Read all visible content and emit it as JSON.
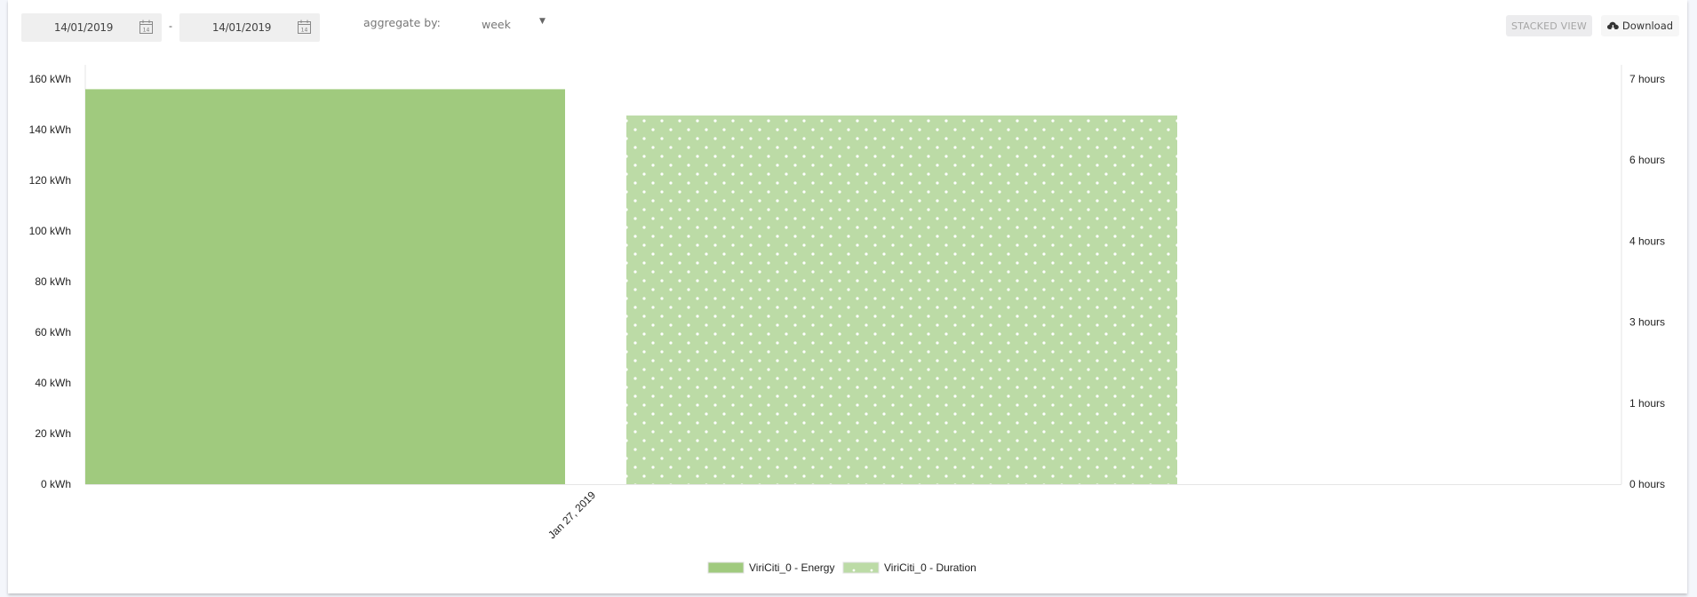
{
  "toolbar": {
    "start_date": "14/01/2019",
    "end_date": "14/01/2019",
    "date_separator": "-",
    "calendar_icon_day": "14",
    "aggregate_label": "aggregate by:",
    "aggregate_value": "week",
    "stacked_view_label": "STACKED VIEW",
    "download_label": "Download"
  },
  "colors": {
    "energy": "#a0ca7e",
    "duration": "#bcdba6",
    "page_background": "#f4f6fb"
  },
  "chart_data": {
    "type": "bar",
    "title": "",
    "categories": [
      "Jan 27, 2019"
    ],
    "series": [
      {
        "name": "ViriCiti_0 - Energy",
        "axis": "left",
        "unit": "kWh",
        "values": [
          156
        ],
        "pattern": "solid"
      },
      {
        "name": "ViriCiti_0 - Duration",
        "axis": "right",
        "unit": "hours",
        "values": [
          6.37
        ],
        "pattern": "dots"
      }
    ],
    "y_left": {
      "label": "",
      "range": [
        0,
        160
      ],
      "ticks": [
        0,
        20,
        40,
        60,
        80,
        100,
        120,
        140,
        160
      ],
      "tick_labels": [
        "0 kWh",
        "20 kWh",
        "40 kWh",
        "60 kWh",
        "80 kWh",
        "100 kWh",
        "120 kWh",
        "140 kWh",
        "160 kWh"
      ]
    },
    "y_right": {
      "label": "",
      "range": [
        0,
        7
      ],
      "ticks": [
        0,
        1.4,
        2.8,
        4.2,
        5.6,
        7
      ],
      "tick_labels": [
        "0 hours",
        "1 hours",
        "3 hours",
        "4 hours",
        "6 hours",
        "7 hours"
      ]
    },
    "x_tick_label_rotation": "-45deg",
    "grid": false,
    "legend": {
      "position": "bottom-center",
      "entries": [
        "ViriCiti_0 - Energy",
        "ViriCiti_0 - Duration"
      ]
    }
  }
}
